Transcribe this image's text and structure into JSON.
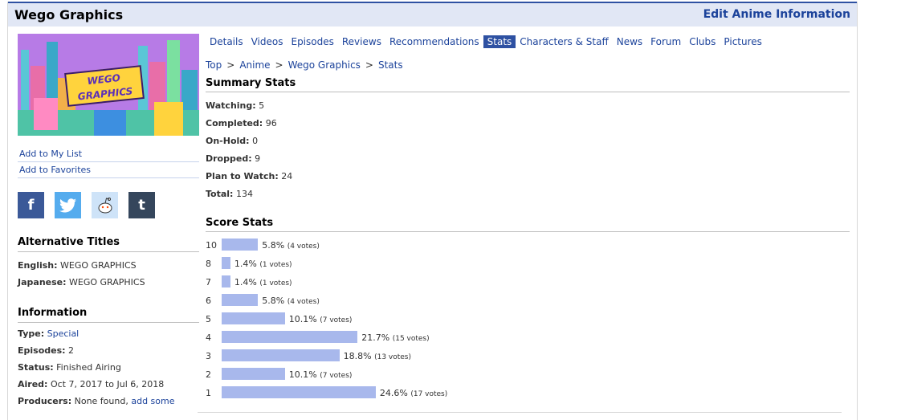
{
  "header": {
    "title": "Wego Graphics",
    "edit_label": "Edit Anime Information"
  },
  "cover": {
    "logo_line1": "WEGO",
    "logo_line2": "GRAPHICS"
  },
  "side_links": [
    "Add to My List",
    "Add to Favorites"
  ],
  "share": {
    "facebook": "f",
    "twitter": "t",
    "reddit": "r",
    "tumblr": "t"
  },
  "alt_titles": {
    "heading": "Alternative Titles",
    "english_key": "English:",
    "english_val": "WEGO GRAPHICS",
    "japanese_key": "Japanese:",
    "japanese_val": "WEGO GRAPHICS"
  },
  "information": {
    "heading": "Information",
    "type_key": "Type:",
    "type_val": "Special",
    "episodes_key": "Episodes:",
    "episodes_val": "2",
    "status_key": "Status:",
    "status_val": "Finished Airing",
    "aired_key": "Aired:",
    "aired_val": "Oct 7, 2017 to Jul 6, 2018",
    "producers_key": "Producers:",
    "producers_val": "None found,",
    "producers_link": "add some"
  },
  "tabs": [
    "Details",
    "Videos",
    "Episodes",
    "Reviews",
    "Recommendations",
    "Stats",
    "Characters & Staff",
    "News",
    "Forum",
    "Clubs",
    "Pictures"
  ],
  "active_tab": "Stats",
  "breadcrumb": [
    "Top",
    "Anime",
    "Wego Graphics",
    "Stats"
  ],
  "summary": {
    "heading": "Summary Stats",
    "rows": [
      {
        "key": "Watching:",
        "val": "5"
      },
      {
        "key": "Completed:",
        "val": "96"
      },
      {
        "key": "On-Hold:",
        "val": "0"
      },
      {
        "key": "Dropped:",
        "val": "9"
      },
      {
        "key": "Plan to Watch:",
        "val": "24"
      },
      {
        "key": "Total:",
        "val": "134"
      }
    ]
  },
  "scores": {
    "heading": "Score Stats",
    "bar_color": "#a8b8ec",
    "rows": [
      {
        "score": "10",
        "pct": 5.8,
        "pct_label": "5.8%",
        "votes": "(4 votes)"
      },
      {
        "score": "8",
        "pct": 1.4,
        "pct_label": "1.4%",
        "votes": "(1 votes)"
      },
      {
        "score": "7",
        "pct": 1.4,
        "pct_label": "1.4%",
        "votes": "(1 votes)"
      },
      {
        "score": "6",
        "pct": 5.8,
        "pct_label": "5.8%",
        "votes": "(4 votes)"
      },
      {
        "score": "5",
        "pct": 10.1,
        "pct_label": "10.1%",
        "votes": "(7 votes)"
      },
      {
        "score": "4",
        "pct": 21.7,
        "pct_label": "21.7%",
        "votes": "(15 votes)"
      },
      {
        "score": "3",
        "pct": 18.8,
        "pct_label": "18.8%",
        "votes": "(13 votes)"
      },
      {
        "score": "2",
        "pct": 10.1,
        "pct_label": "10.1%",
        "votes": "(7 votes)"
      },
      {
        "score": "1",
        "pct": 24.6,
        "pct_label": "24.6%",
        "votes": "(17 votes)"
      }
    ]
  }
}
